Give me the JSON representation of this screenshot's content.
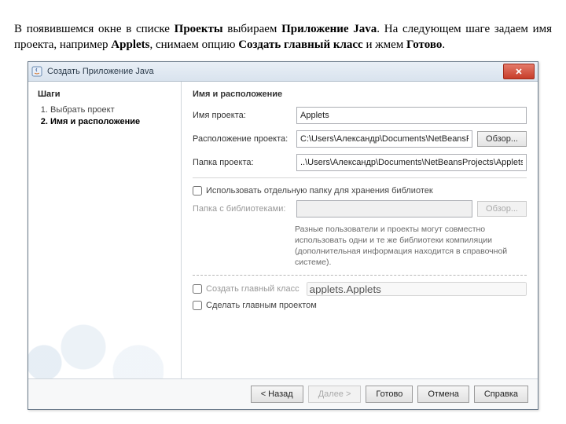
{
  "intro": {
    "t1": "В появившемся окне в списке ",
    "b1": "Проекты",
    "t2": " выбираем ",
    "b2": "Приложение Java",
    "t3": ". На следующем шаге задаем имя проекта, например ",
    "b3": "Applets",
    "t4": ", снимаем опцию ",
    "b4": "Создать главный класс",
    "t5": " и жмем ",
    "b5": "Готово",
    "t6": "."
  },
  "dialog": {
    "title": "Создать Приложение Java",
    "steps_heading": "Шаги",
    "steps": [
      "Выбрать проект",
      "Имя и расположение"
    ],
    "panel_heading": "Имя и расположение",
    "project_name_label": "Имя проекта:",
    "project_name_value": "Applets",
    "project_location_label": "Расположение проекта:",
    "project_location_value": "C:\\Users\\Александр\\Documents\\NetBeansProjects",
    "project_folder_label": "Папка проекта:",
    "project_folder_value": "..\\Users\\Александр\\Documents\\NetBeansProjects\\Applets",
    "browse": "Обзор...",
    "use_dedicated_lib_label": "Использовать отдельную папку для хранения библиотек",
    "lib_folder_label": "Папка с библиотеками:",
    "lib_hint": "Разные пользователи и проекты могут совместно использовать одни и те же библиотеки компиляции (дополнительная информация находится в справочной системе).",
    "create_main_class_label": "Создать главный класс",
    "create_main_class_value": "applets.Applets",
    "set_main_project_label": "Сделать главным проектом",
    "buttons": {
      "back": "< Назад",
      "next": "Далее >",
      "finish": "Готово",
      "cancel": "Отмена",
      "help": "Справка"
    }
  }
}
